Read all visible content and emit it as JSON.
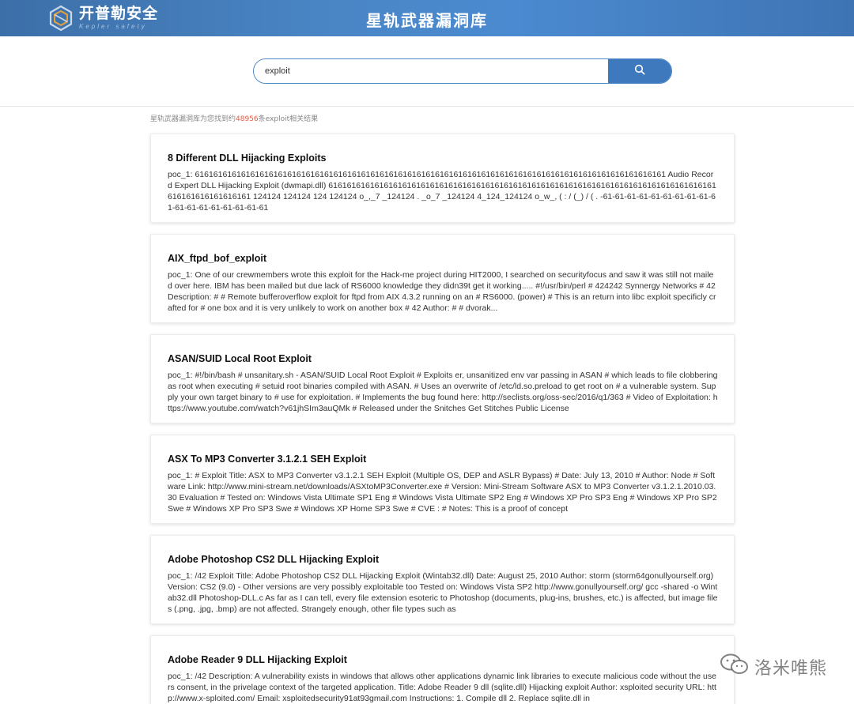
{
  "header": {
    "logo_cn": "开普勒安全",
    "logo_en": "Kepler safety",
    "title": "星轨武器漏洞库",
    "bg_color": "#4a86c6"
  },
  "search": {
    "value": "exploit",
    "button_icon": "search-icon",
    "accent_color": "#3f79bd"
  },
  "summary": {
    "prefix": "星轨武器漏洞库为您找到约",
    "count": "48956",
    "suffix": "条exploit相关结果",
    "count_color": "#e9573f"
  },
  "results": [
    {
      "title": "8 Different DLL Hijacking Exploits",
      "snippet": "poc_1: 616161616161616161616161616161616161616161616161616161616161616161616161616161616161616161616161616161 Audio Record Expert DLL Hijacking Exploit (dwmapi.dll) 616161616161616161616161616161616161616161616161616161616161616161616161616161616161616161616161616161 124124 124124 124 124124 o_,_7 _124124 . _o_7 _124124 4_124_124124 o_w_, ( : / (_) / ( . -61-61-61-61-61-61-61-61-61-61-61-61-61-61-61-61-61-61"
    },
    {
      "title": "AIX_ftpd_bof_exploit",
      "snippet": "poc_1: One of our crewmembers wrote this exploit for the Hack-me project during HIT2000, I searched on securityfocus and saw it was still not mailed over here. IBM has been mailed but due lack of RS6000 knowledge they didn39t get it working..... #!/usr/bin/perl # 424242 Synnergy Networks # 42 Description: # # Remote bufferoverflow exploit for ftpd from AIX 4.3.2 running on an # RS6000. (power) # This is an return into libc exploit specificly crafted for # one box and it is very unlikely to work on another box # 42 Author: # # dvorak..."
    },
    {
      "title": "ASAN/SUID Local Root Exploit",
      "snippet": "poc_1: #!/bin/bash # unsanitary.sh - ASAN/SUID Local Root Exploit # Exploits er, unsanitized env var passing in ASAN # which leads to file clobbering as root when executing # setuid root binaries compiled with ASAN. # Uses an overwrite of /etc/ld.so.preload to get root on # a vulnerable system. Supply your own target binary to # use for exploitation. # Implements the bug found here: http://seclists.org/oss-sec/2016/q1/363 # Video of Exploitation: https://www.youtube.com/watch?v61jhSIm3auQMk # Released under the Snitches Get Stitches Public License"
    },
    {
      "title": "ASX To MP3 Converter 3.1.2.1 SEH Exploit",
      "snippet": "poc_1: # Exploit Title: ASX to MP3 Converter v3.1.2.1 SEH Exploit (Multiple OS, DEP and ASLR Bypass) # Date: July 13, 2010 # Author: Node # Software Link: http://www.mini-stream.net/downloads/ASXtoMP3Converter.exe # Version: Mini-Stream Software ASX to MP3 Converter v3.1.2.1.2010.03.30 Evaluation # Tested on: Windows Vista Ultimate SP1 Eng # Windows Vista Ultimate SP2 Eng # Windows XP Pro SP3 Eng # Windows XP Pro SP2 Swe # Windows XP Pro SP3 Swe # Windows XP Home SP3 Swe # CVE : # Notes: This is a proof of concept"
    },
    {
      "title": "Adobe Photoshop CS2 DLL Hijacking Exploit",
      "snippet": "poc_1: /42 Exploit Title: Adobe Photoshop CS2 DLL Hijacking Exploit (Wintab32.dll) Date: August 25, 2010 Author: storm (storm64gonullyourself.org) Version: CS2 (9.0) - Other versions are very possibly exploitable too Tested on: Windows Vista SP2 http://www.gonullyourself.org/ gcc -shared -o Wintab32.dll Photoshop-DLL.c As far as I can tell, every file extension esoteric to Photoshop (documents, plug-ins, brushes, etc.) is affected, but image files (.png, .jpg, .bmp) are not affected. Strangely enough, other file types such as"
    },
    {
      "title": "Adobe Reader 9 DLL Hijacking Exploit",
      "snippet": "poc_1: /42 Description: A vulnerability exists in windows that allows other applications dynamic link libraries to execute malicious code without the users consent, in the privelage context of the targeted application. Title: Adobe Reader 9 dll (sqlite.dll) Hijacking exploit Author: xsploited security URL: http://www.x-sploited.com/ Email: xsploitedsecurity91at93gmail.com Instructions: 1. Compile dll 2. Replace sqlite.dll in"
    }
  ],
  "watermark": {
    "text": "洛米唯熊",
    "icon": "wechat-icon"
  }
}
